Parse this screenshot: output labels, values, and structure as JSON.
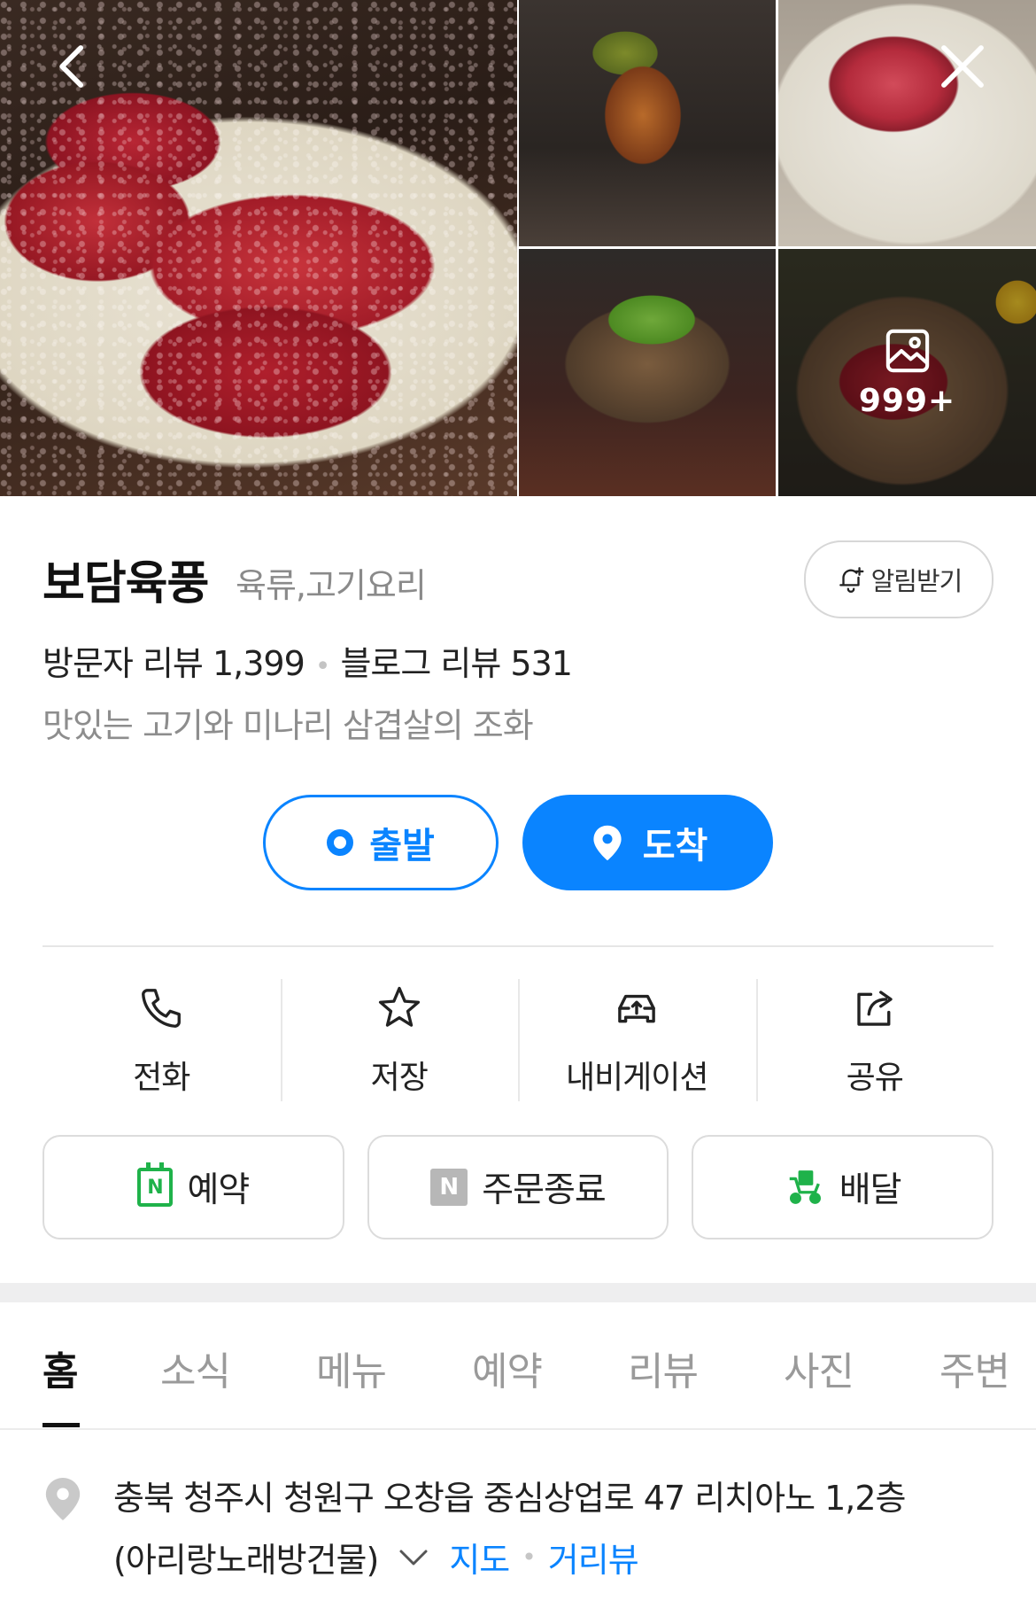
{
  "gallery": {
    "more_count": "999+"
  },
  "place": {
    "name": "보담육풍",
    "category": "육류,고기요리",
    "alert_label": "알림받기",
    "visitor_review": "방문자 리뷰 1,399",
    "blog_review": "블로그 리뷰 531",
    "tagline": "맛있는 고기와 미나리 삼겹살의 조화"
  },
  "route": {
    "start_label": "출발",
    "end_label": "도착"
  },
  "actions": [
    {
      "label": "전화",
      "icon": "phone-icon"
    },
    {
      "label": "저장",
      "icon": "star-icon"
    },
    {
      "label": "내비게이션",
      "icon": "car-navigation-icon"
    },
    {
      "label": "공유",
      "icon": "share-icon"
    }
  ],
  "features": [
    {
      "label": "예약",
      "icon": "calendar-n-icon"
    },
    {
      "label": "주문종료",
      "icon": "naver-n-icon"
    },
    {
      "label": "배달",
      "icon": "delivery-scooter-icon"
    }
  ],
  "tabs": [
    "홈",
    "소식",
    "메뉴",
    "예약",
    "리뷰",
    "사진",
    "주변"
  ],
  "active_tab": "홈",
  "address": {
    "line1": "충북 청주시 청원구 오창읍 중심상업로 47 리치아노 1,2층",
    "line2": "(아리랑노래방건물)",
    "map_link": "지도",
    "street_view_link": "거리뷰"
  },
  "colors": {
    "accent": "#0a84ff",
    "reservation_green": "#1fb24a",
    "muted_text": "#8d8d8d"
  }
}
